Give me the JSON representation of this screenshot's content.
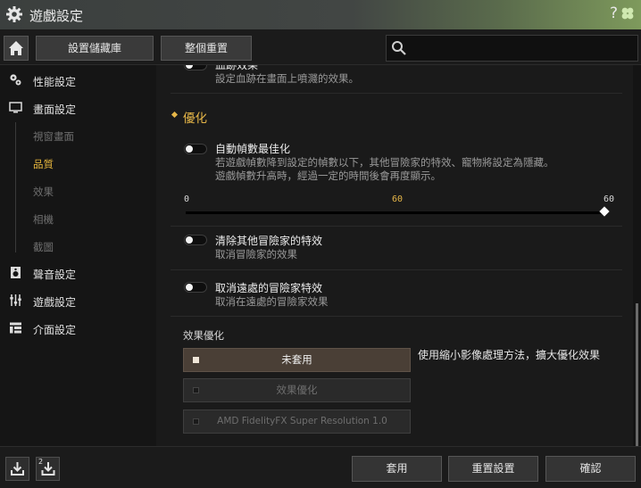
{
  "window": {
    "title": "遊戲設定",
    "help_label": "?",
    "icons": [
      "gear-icon",
      "clover-icon"
    ]
  },
  "toolbar": {
    "save_library_label": "設置儲藏庫",
    "reset_all_label": "整個重置",
    "search_placeholder": ""
  },
  "sidebar": {
    "items": [
      {
        "label": "性能設定",
        "icon": "performance-gears-icon"
      },
      {
        "label": "畫面設定",
        "icon": "monitor-icon"
      },
      {
        "label": "視窗畫面",
        "sub": true
      },
      {
        "label": "品質",
        "sub": true,
        "active": true
      },
      {
        "label": "效果",
        "sub": true
      },
      {
        "label": "相機",
        "sub": true
      },
      {
        "label": "截圖",
        "sub": true
      },
      {
        "label": "聲音設定",
        "icon": "speaker-icon"
      },
      {
        "label": "遊戲設定",
        "icon": "sliders-icon"
      },
      {
        "label": "介面設定",
        "icon": "interface-icon"
      }
    ]
  },
  "main": {
    "partial_option": {
      "title": "血跡效果",
      "desc": "設定血跡在畫面上噴濺的效果。"
    },
    "section_title": "優化",
    "auto_fps": {
      "title": "自動幀數最佳化",
      "desc_line1": "若遊戲幀數降到設定的幀數以下，其他冒險家的特效、寵物將設定為隱藏。",
      "desc_line2": "遊戲幀數升高時，經過一定的時間後會再度顯示。",
      "slider": {
        "min_label": "0",
        "mid_label": "60",
        "max_label": "60",
        "value": 60,
        "max": 60,
        "accent": "#e6b648"
      }
    },
    "clear_others": {
      "title": "清除其他冒險家的特效",
      "desc": "取消冒險家的效果"
    },
    "far_effects": {
      "title": "取消遠處的冒險家特效",
      "desc": "取消在遠處的冒險家效果"
    },
    "effect_opt": {
      "label": "效果優化",
      "note": "使用縮小影像處理方法，擴大優化效果",
      "options": [
        {
          "label": "未套用",
          "selected": true
        },
        {
          "label": "效果優化",
          "selected": false
        },
        {
          "label": "AMD FidelityFX Super Resolution 1.0",
          "selected": false
        }
      ]
    }
  },
  "bottom": {
    "apply_label": "套用",
    "reset_label": "重置設置",
    "confirm_label": "確認",
    "slot2_label": "2"
  },
  "colors": {
    "accent": "#e6b648",
    "selected_option_bg": "#4a3f36"
  }
}
